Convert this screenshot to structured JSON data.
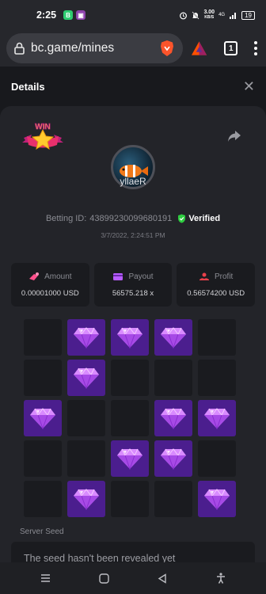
{
  "status_bar": {
    "time": "2:25",
    "app_icons": [
      {
        "name": "messages-app",
        "letter": "B",
        "color": "#2ecc71"
      },
      {
        "name": "video-app",
        "letter": "▣",
        "color": "#8e44ad"
      }
    ],
    "net_speed_value": "3.00",
    "net_speed_unit": "KB/S",
    "signal": "4G",
    "battery": "19"
  },
  "browser": {
    "url": "bc.game/mines",
    "tab_count": "1"
  },
  "details": {
    "title": "Details",
    "close": "✕"
  },
  "bet": {
    "badge_text": "WIN",
    "username": "yllaeR",
    "betting_id_label": "Betting ID:",
    "betting_id": "43899230099680191",
    "verified_label": "Verified",
    "date": "3/7/2022, 2:24:51 PM"
  },
  "stats": [
    {
      "label": "Amount",
      "value": "0.00001000 USD",
      "icon": "money-icon",
      "color": "#ff4f8b"
    },
    {
      "label": "Payout",
      "value": "56575.218 x",
      "icon": "card-icon",
      "color": "#b85cff"
    },
    {
      "label": "Profit",
      "value": "0.56574200 USD",
      "icon": "profit-icon",
      "color": "#e8404a"
    }
  ],
  "grid": {
    "rows": 5,
    "cols": 5,
    "gem_cells": [
      1,
      2,
      3,
      6,
      10,
      13,
      14,
      17,
      18,
      21,
      24
    ]
  },
  "server_seed": {
    "label": "Server Seed",
    "value": "The seed hasn't been revealed yet"
  },
  "colors": {
    "gem_tile": "#4b1e8e",
    "empty_tile": "#1a1b1f",
    "verified": "#2ecc40"
  }
}
